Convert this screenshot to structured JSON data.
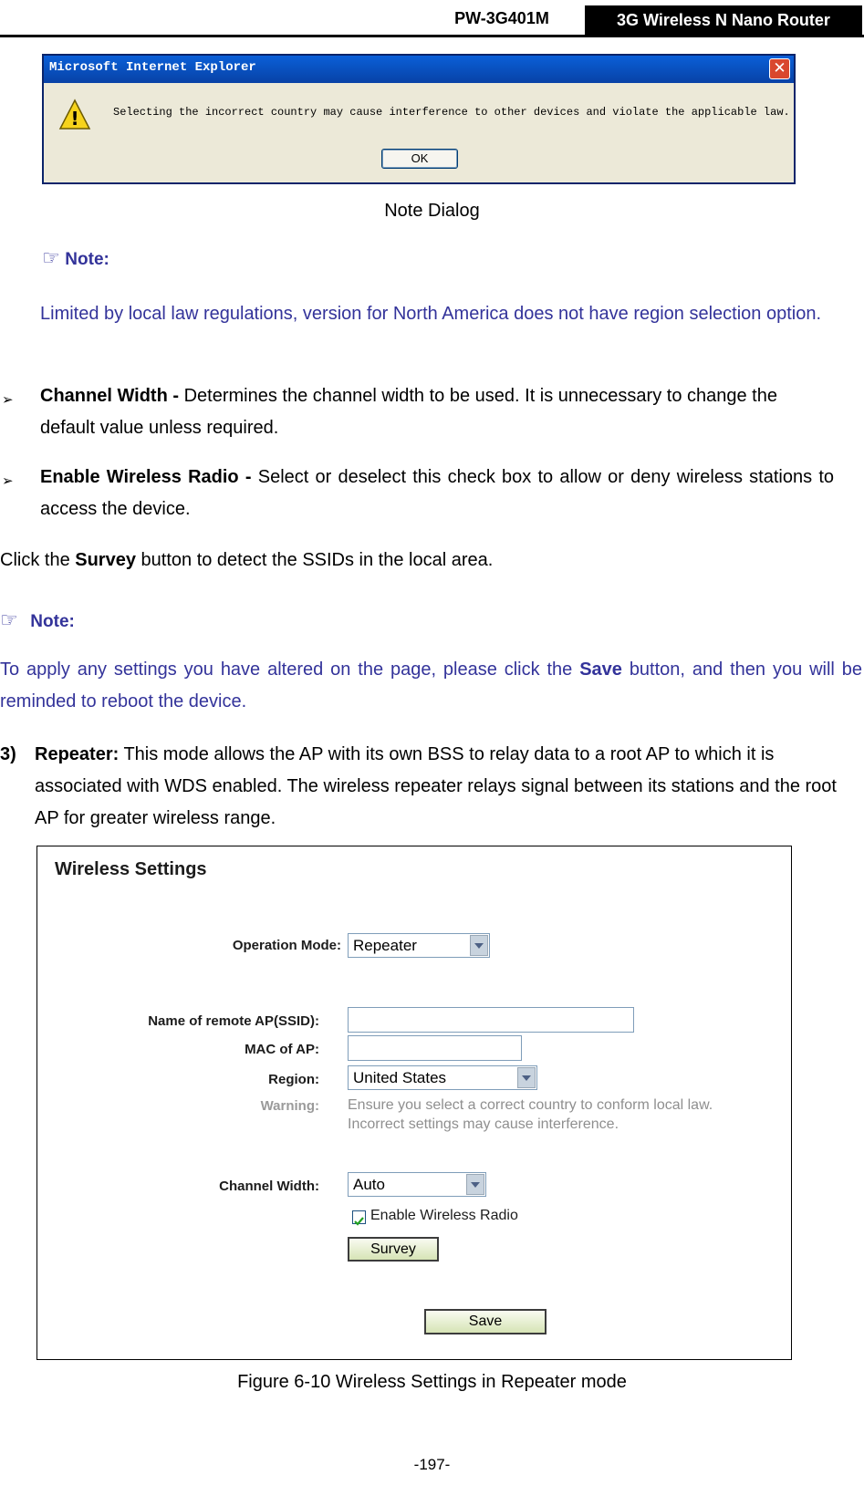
{
  "header": {
    "model": "PW-3G401M",
    "product": "3G Wireless N Nano Router"
  },
  "dialog": {
    "title": "Microsoft Internet Explorer",
    "message": "Selecting the incorrect country may cause interference to other devices and violate the applicable law.",
    "ok_label": "OK",
    "close_label": "✕",
    "warning_glyph": "!"
  },
  "caption_dialog": "Note Dialog",
  "note1": {
    "title": "Note:",
    "text": "Limited by local law regulations, version for North America does not have region selection option."
  },
  "bullets": [
    {
      "term": "Channel Width - ",
      "text": "Determines the channel width to be used. It is unnecessary to change the default value unless required."
    },
    {
      "term": "Enable Wireless Radio - ",
      "text": "Select or deselect this check box to allow or deny wireless stations to access the device."
    }
  ],
  "survey_line": {
    "pre": "Click the ",
    "bold": "Survey",
    "post": " button to detect the SSIDs in the local area."
  },
  "note2": {
    "title": "Note:",
    "pre": "To apply any settings you have altered on the page, please click the ",
    "bold": "Save",
    "post": " button, and then you will be reminded to reboot the device."
  },
  "item3": {
    "number": "3)",
    "term": "Repeater:",
    "text": " This mode allows the AP with its own BSS to relay data to a root AP to which it is associated with WDS enabled. The wireless repeater relays signal between its stations and the root AP for greater wireless range."
  },
  "wireless_settings": {
    "title": "Wireless Settings",
    "operation_mode": {
      "label": "Operation Mode:",
      "value": "Repeater"
    },
    "ssid": {
      "label": "Name of remote AP(SSID):",
      "value": ""
    },
    "mac": {
      "label": "MAC of AP:",
      "value": ""
    },
    "region": {
      "label": "Region:",
      "value": "United States"
    },
    "warning": {
      "label": "Warning:",
      "line1": "Ensure you select a correct country to conform local law.",
      "line2": "Incorrect settings may cause interference."
    },
    "channel_width": {
      "label": "Channel Width:",
      "value": "Auto"
    },
    "enable_radio": {
      "label": "Enable Wireless Radio",
      "checked": true
    },
    "survey_label": "Survey",
    "save_label": "Save"
  },
  "caption_figure": "Figure 6-10 Wireless Settings in Repeater mode",
  "page_number": "-197-",
  "glyphs": {
    "hand": "☞",
    "bullet": "➢",
    "check": "✓"
  }
}
